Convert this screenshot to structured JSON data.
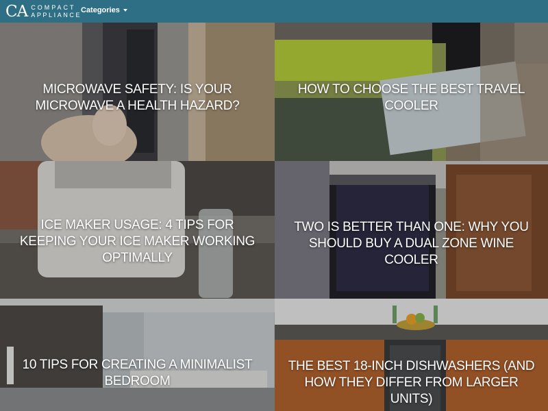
{
  "header": {
    "logo_initials": "CA",
    "logo_line1": "COMPACT",
    "logo_line2": "APPLIANCE",
    "nav_categories": "Categories"
  },
  "colors": {
    "header_bg": "#2f6f86",
    "text": "#ffffff"
  },
  "articles": [
    {
      "title": "Microwave Safety: Is Your Microwave A Health Hazard?"
    },
    {
      "title": "How To Choose The Best Travel Cooler"
    },
    {
      "title": "Ice Maker Usage: 4 Tips For Keeping Your Ice Maker Working Optimally"
    },
    {
      "title": "Two Is Better Than One: Why You Should Buy A Dual Zone Wine Cooler"
    },
    {
      "title": "10 Tips For Creating A Minimalist Bedroom"
    },
    {
      "title": "The Best 18-Inch Dishwashers (And How They Differ From Larger Units)"
    }
  ]
}
